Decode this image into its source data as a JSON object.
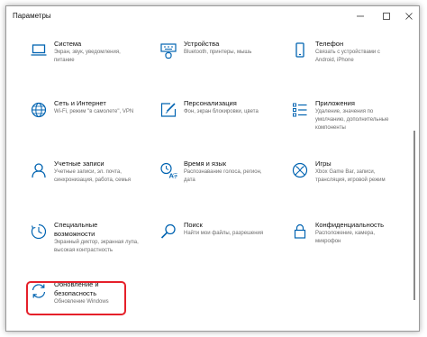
{
  "window": {
    "title": "Параметры"
  },
  "tiles": [
    {
      "name": "Система",
      "desc": "Экран, звук, уведомления, питание",
      "icon": "laptop-icon"
    },
    {
      "name": "Устройства",
      "desc": "Bluetooth, принтеры, мышь",
      "icon": "devices-icon"
    },
    {
      "name": "Телефон",
      "desc": "Связать с устройствами с Android, iPhone",
      "icon": "phone-icon"
    },
    {
      "name": "Сеть и Интернет",
      "desc": "Wi-Fi, режим \"в самолете\", VPN",
      "icon": "globe-icon"
    },
    {
      "name": "Персонализация",
      "desc": "Фон, экран блокировки, цвета",
      "icon": "personalization-icon"
    },
    {
      "name": "Приложения",
      "desc": "Удаление, значения по умолчанию, дополнительные компоненты",
      "icon": "apps-icon"
    },
    {
      "name": "Учетные записи",
      "desc": "Учетные записи, эл. почта, синхронизация, работа, семья",
      "icon": "account-icon"
    },
    {
      "name": "Время и язык",
      "desc": "Распознавание голоса, регион, дата",
      "icon": "time-language-icon"
    },
    {
      "name": "Игры",
      "desc": "Xbox Game Bar, записи, трансляция, игровой режим",
      "icon": "xbox-icon"
    },
    {
      "name": "Специальные возможности",
      "desc": "Экранный диктор, экранная лупа, высокая контрастность",
      "icon": "accessibility-icon"
    },
    {
      "name": "Поиск",
      "desc": "Найти мои файлы, разрешения",
      "icon": "search-icon"
    },
    {
      "name": "Конфиденциальность",
      "desc": "Расположение, камера, микрофон",
      "icon": "lock-icon"
    },
    {
      "name": "Обновление и безопасность",
      "desc": "Обновление Windows",
      "icon": "update-icon"
    }
  ],
  "colors": {
    "accent": "#0063b1",
    "highlight": "#e5202a"
  }
}
